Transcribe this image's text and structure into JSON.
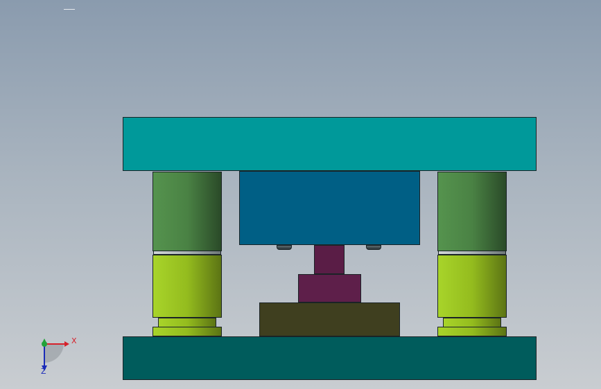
{
  "viewport": {
    "background_top": "#8a9bae",
    "background_bottom": "#c9cdd1"
  },
  "parts": {
    "upper_plate_color": "#00999a",
    "lower_plate_color": "#005c5c",
    "die_block_color": "#005f85",
    "punch_color": "#5e1f4a",
    "base_block_color": "#3f3f1f",
    "upper_bushing_color": "#4a8244",
    "lower_bushing_color": "#94bc1e"
  },
  "triad": {
    "x_label": "X",
    "z_label": "Z",
    "x_color": "#d6202a",
    "y_color": "#23a33a",
    "z_color": "#1a2bb8",
    "icon": "coordinate-triad-icon"
  }
}
